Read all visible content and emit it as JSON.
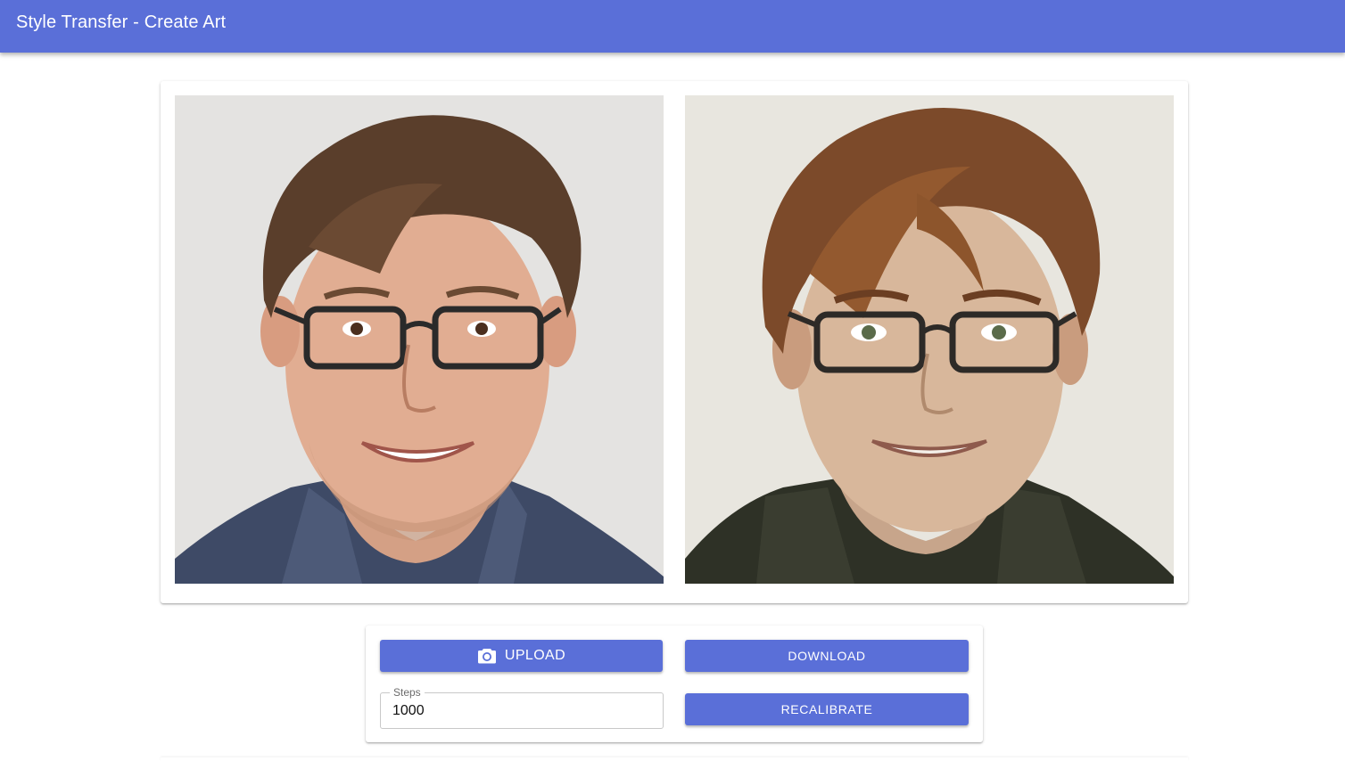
{
  "app": {
    "title": "Style Transfer - Create Art"
  },
  "images": {
    "original": {
      "icon": "portrait-photo"
    },
    "stylized": {
      "icon": "stylized-portrait"
    }
  },
  "controls": {
    "upload_label": "UPLOAD",
    "upload_icon": "camera-icon",
    "download_label": "DOWNLOAD",
    "recalibrate_label": "RECALIBRATE",
    "steps": {
      "label": "Steps",
      "value": "1000"
    }
  },
  "colors": {
    "primary": "#5a6fd8",
    "on_primary": "#ffffff",
    "background": "#ffffff"
  }
}
